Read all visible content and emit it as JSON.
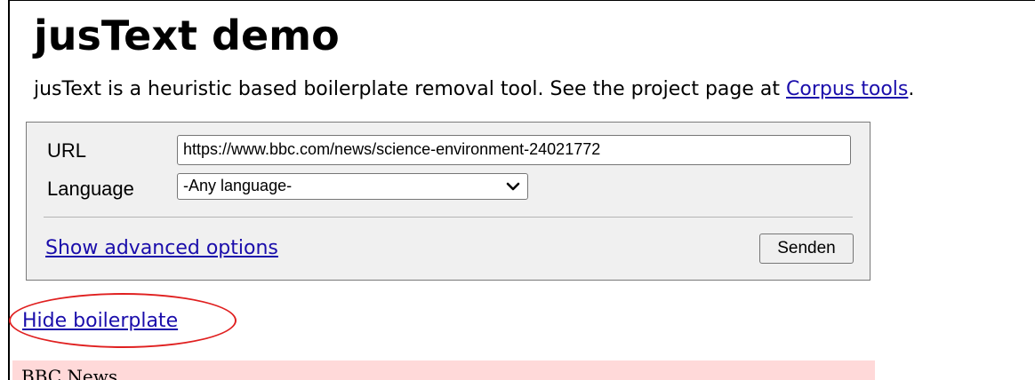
{
  "page": {
    "title": "jusText demo",
    "intro_text": "jusText is a heuristic based boilerplate removal tool. See the project page at ",
    "intro_link": "Corpus tools",
    "intro_end": "."
  },
  "form": {
    "url_label": "URL",
    "url_value": "https://www.bbc.com/news/science-environment-24021772",
    "language_label": "Language",
    "language_selected": "-Any language-",
    "advanced_link": "Show advanced options",
    "submit_label": "Senden"
  },
  "result": {
    "toggle_link": "Hide boilerplate",
    "first_block_text": "BBC News"
  },
  "colors": {
    "link": "#1a0dab",
    "form_background": "#f0f0f0",
    "boilerplate_background": "#ffd9d9",
    "highlight_ring": "#e02020"
  },
  "icons": {
    "select_arrow": "chevron-down-icon"
  }
}
